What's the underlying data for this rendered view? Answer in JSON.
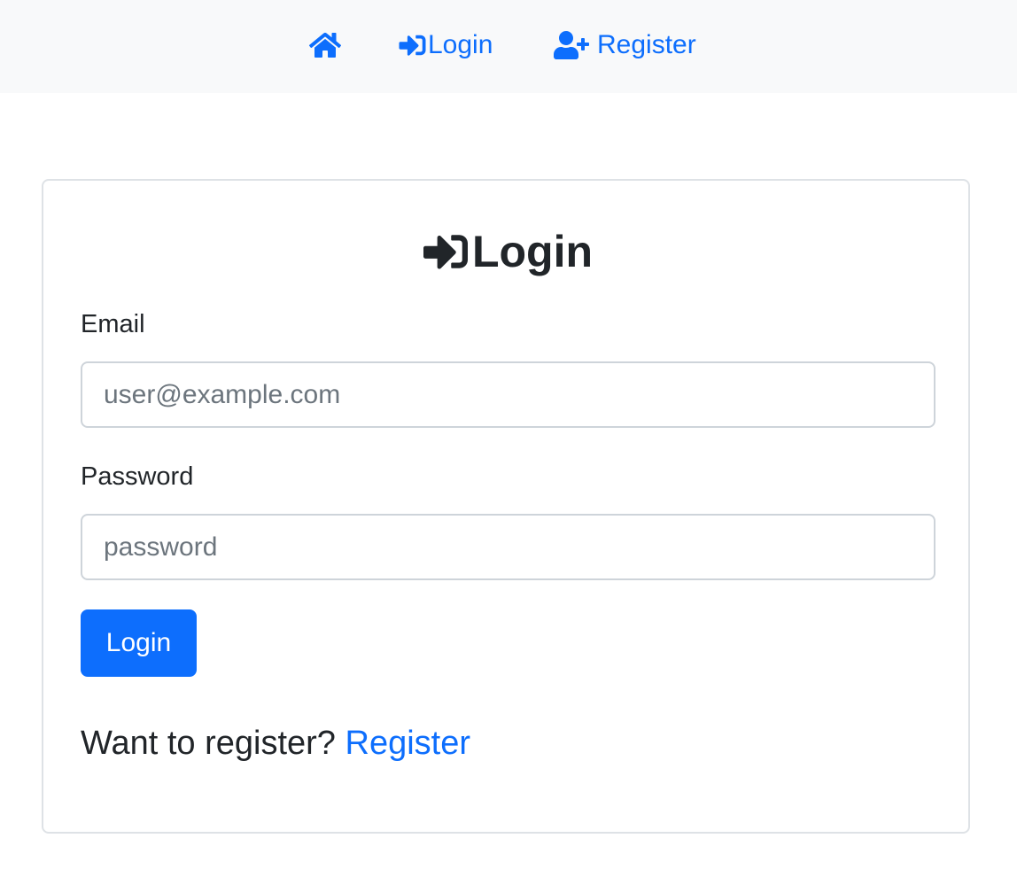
{
  "navbar": {
    "home_icon": "home-icon",
    "login_icon": "sign-in-icon",
    "login_label": "Login",
    "register_icon": "user-plus-icon",
    "register_label": "Register"
  },
  "login_card": {
    "title_icon": "sign-in-icon",
    "title": "Login",
    "email_label": "Email",
    "email_placeholder": "user@example.com",
    "email_value": "",
    "password_label": "Password",
    "password_placeholder": "password",
    "password_value": "",
    "submit_label": "Login",
    "register_prompt": "Want to register?",
    "register_link": "Register"
  },
  "colors": {
    "accent": "#0d6efd",
    "navbar_bg": "#f8f9fa",
    "text": "#212529",
    "placeholder": "#6c757d",
    "border": "#ced4da"
  }
}
